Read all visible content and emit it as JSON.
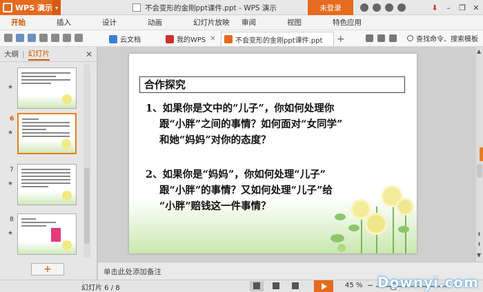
{
  "app": {
    "name": "WPS 演示",
    "doc_title": "不会变形的金刚ppt课件.ppt - WPS 演示",
    "login": "未登录"
  },
  "menu": [
    "开始",
    "插入",
    "设计",
    "动画",
    "幻灯片放映",
    "审阅",
    "视图",
    "特色应用"
  ],
  "tabs": [
    {
      "label": "云文档",
      "color": "#3d7fd6"
    },
    {
      "label": "我的WPS",
      "color": "#d03030"
    },
    {
      "label": "不会变形的金刚ppt课件.ppt",
      "color": "#e66a1e"
    }
  ],
  "search_label": "查找命令、搜索模板",
  "panel": {
    "tab_outline": "大纲",
    "tab_slides": "幻灯片"
  },
  "thumbs": [
    {
      "num": "",
      "current": false
    },
    {
      "num": "6",
      "current": true
    },
    {
      "num": "7",
      "current": false
    },
    {
      "num": "8",
      "current": false
    }
  ],
  "slide": {
    "title": "合作探究",
    "q1_line1": "1、如果你是文中的“儿子”，你如何处理你",
    "q1_line2": "跟“小胖”之间的事情？如何面对“女同学”",
    "q1_line3": "和她“妈妈”对你的态度？",
    "q2_line1": "2、如果你是“妈妈”，你如何处理“儿子”",
    "q2_line2": "跟“小胖”的事情？又如何处理“儿子”给",
    "q2_line3": "“小胖”赔钱这一件事情？"
  },
  "notes_placeholder": "单击此处添加备注",
  "status": {
    "page": "幻灯片 6 / 8",
    "zoom": "45 %",
    "zoom_fraction": 0.25
  },
  "watermark": "Downyi.com"
}
